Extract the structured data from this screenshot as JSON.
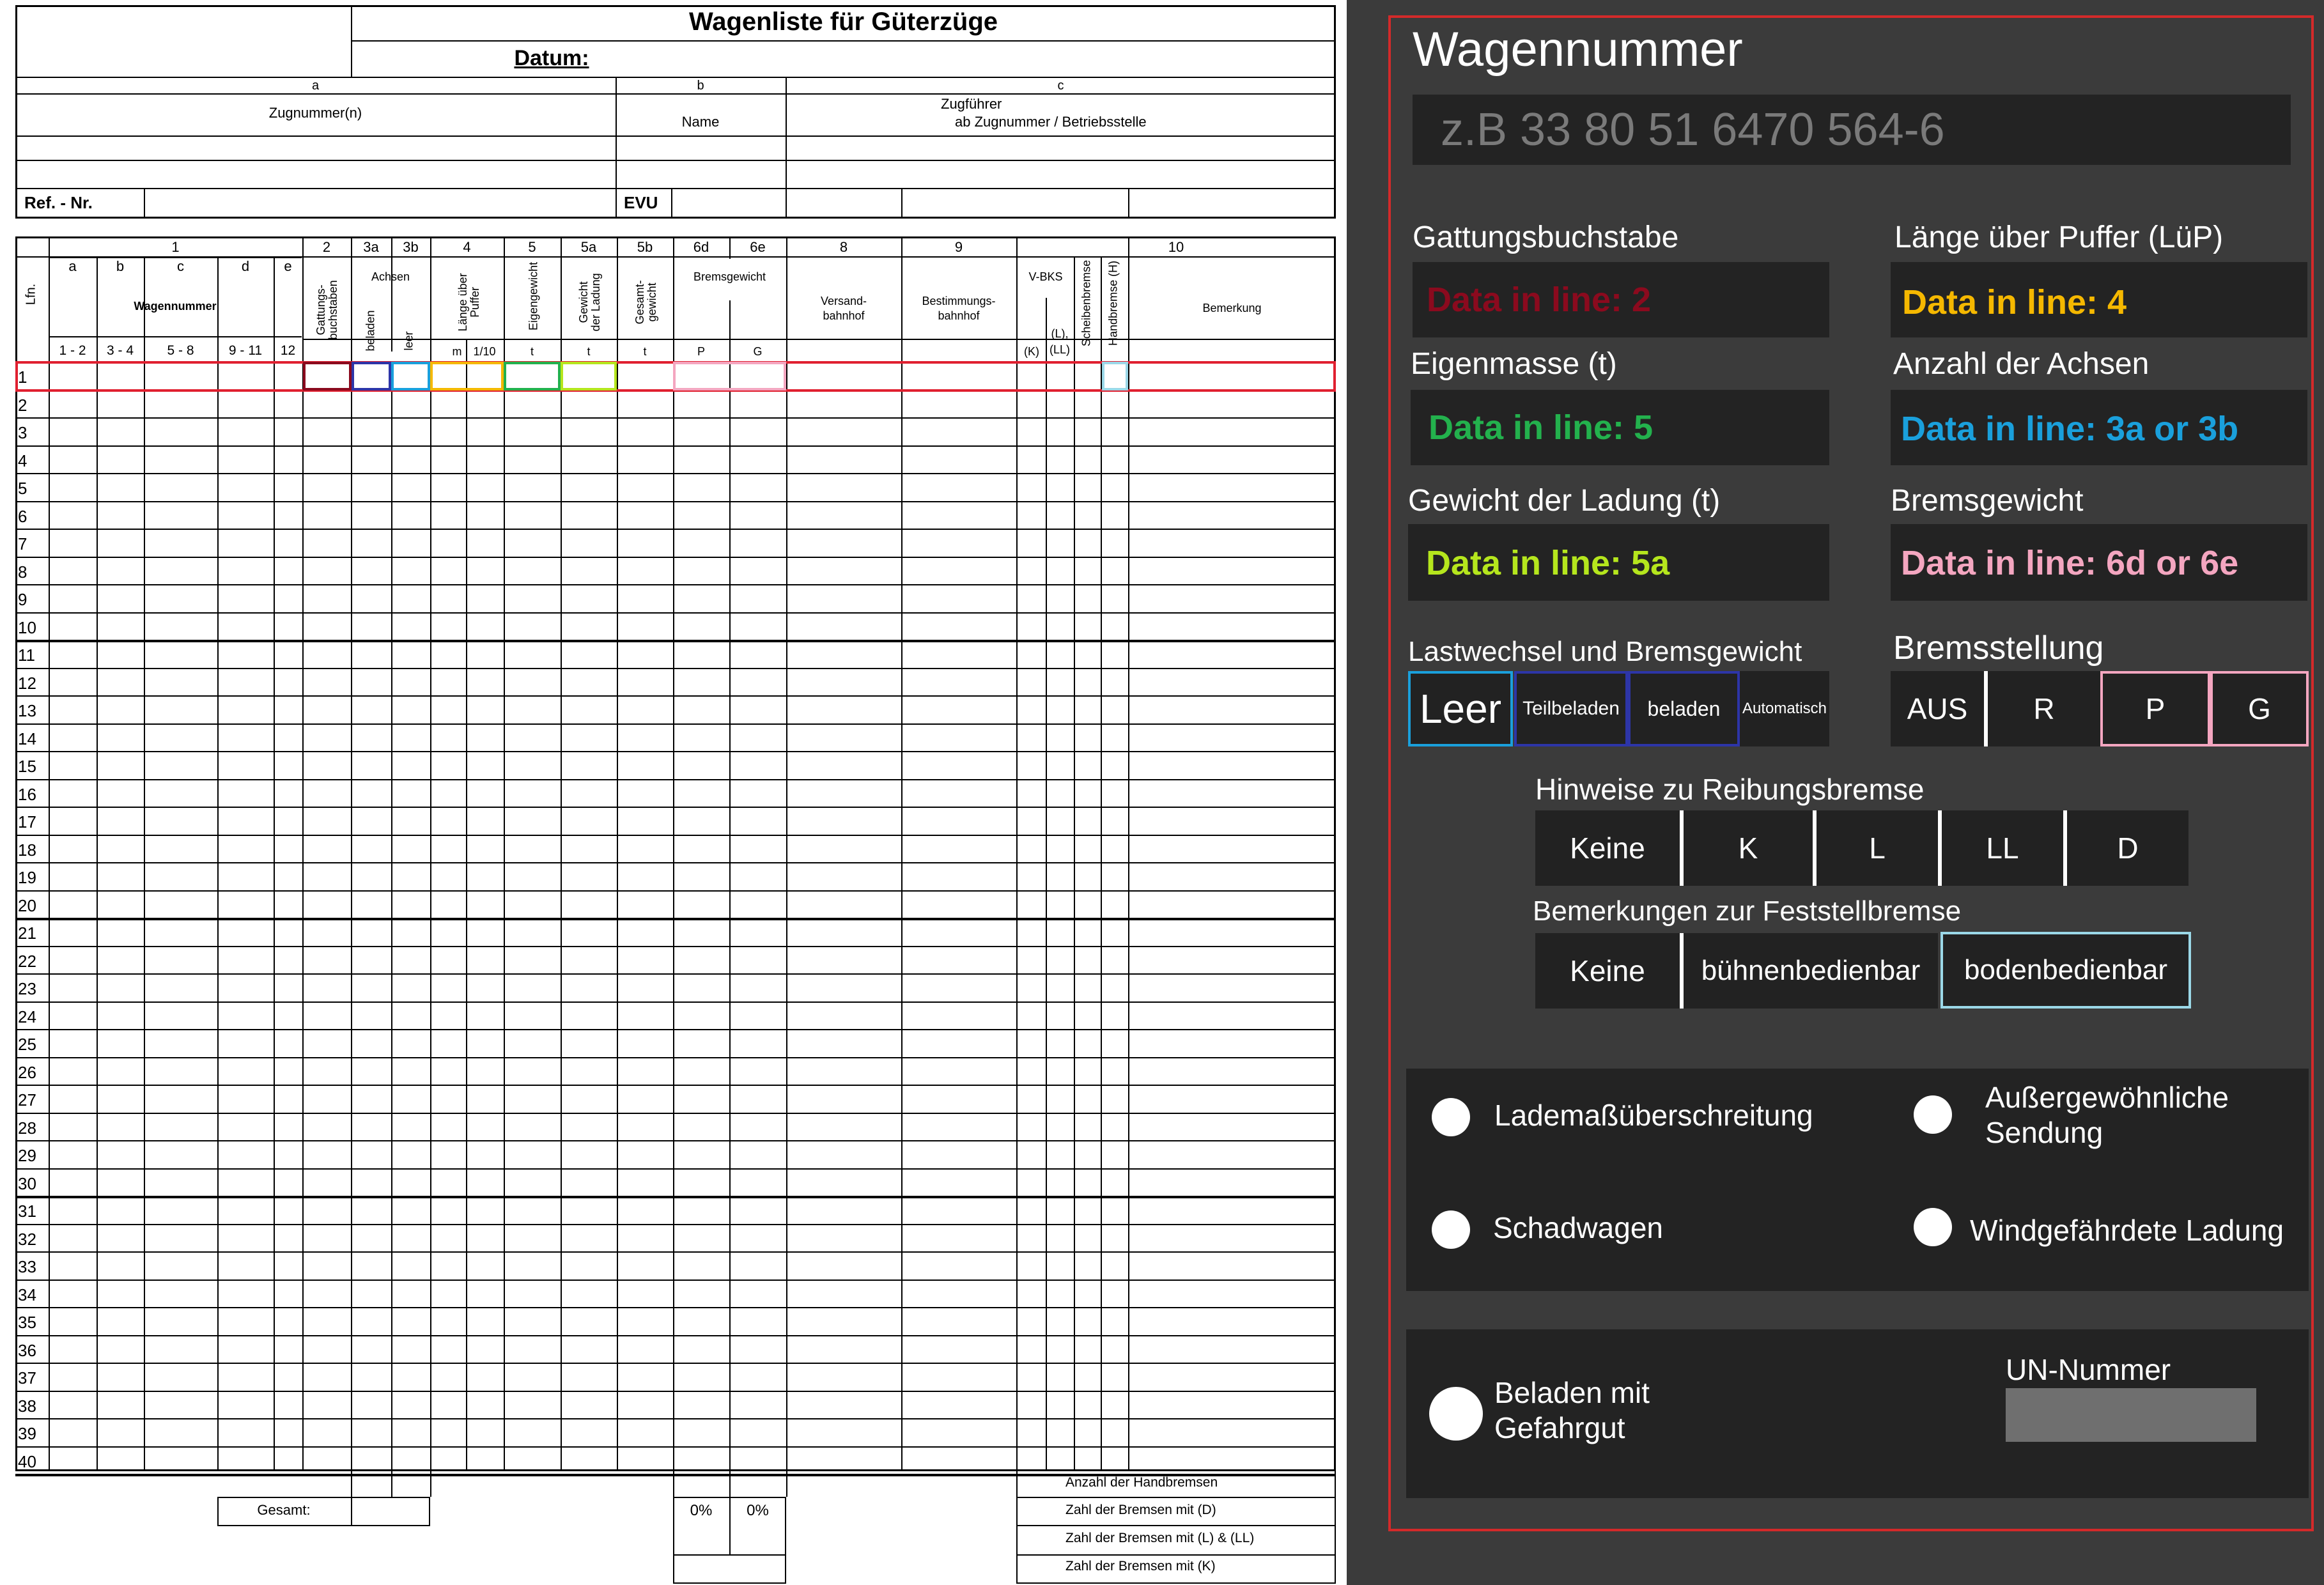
{
  "form": {
    "title": "Wagenliste für Güterzüge",
    "datum_label": "Datum:",
    "col_a": "a",
    "col_b": "b",
    "col_c": "c",
    "zugnummer": "Zugnummer(n)",
    "name": "Name",
    "zugfuehrer": "Zugführer",
    "ab_zugnummer": "ab Zugnummer / Betriebsstelle",
    "ref_nr": "Ref. - Nr.",
    "evu": "EVU",
    "colnums": [
      "1",
      "2",
      "3a",
      "3b",
      "4",
      "5",
      "5a",
      "5b",
      "6d",
      "6e",
      "8",
      "9",
      "10"
    ],
    "lfn": "Lfn.",
    "sub_letters": [
      "a",
      "b",
      "c",
      "d",
      "e"
    ],
    "wagennummer": "Wagennummer",
    "digit_groups": [
      "1 - 2",
      "3 - 4",
      "5 - 8",
      "9 - 11",
      "12"
    ],
    "gattung": "Gattungs-\nbuchstaben",
    "achsen": "Achsen",
    "beladen": "beladen",
    "leer": "leer",
    "laenge": "Länge über\nPuffer",
    "m": "m",
    "zehntel": "1/10",
    "eigengewicht": "Eigengewicht",
    "gewicht_ladung": "Gewicht\nder Ladung",
    "gesamtgewicht": "Gesamt-\ngewicht",
    "t": "t",
    "bremsgewicht": "Bremsgewicht",
    "p": "P",
    "g": "G",
    "versand": "Versand-\nbahnhof",
    "bestimmung": "Bestimmungs-\nbahnhof",
    "vbks": "V-BKS",
    "k_paren": "(K)",
    "l_ll": "(L),\n(LL)",
    "scheibenbremse": "Scheibenbremse",
    "handbremse": "Handbremse (H)",
    "bemerkung": "Bemerkung",
    "gesamt": "Gesamt:",
    "pct_p": "0%",
    "pct_g": "0%",
    "anzahl_hand": "Anzahl der Handbremsen",
    "zahl_d": "Zahl der Bremsen mit (D)",
    "zahl_l": "Zahl der Bremsen mit (L) & (LL)",
    "zahl_k": "Zahl der Bremsen mit (K)",
    "row_count": 40
  },
  "app": {
    "wagennummer_label": "Wagennummer",
    "wagennummer_placeholder": "z.B 33 80 51 6470 564-6",
    "gattung_label": "Gattungsbuchstabe",
    "gattung_value": "Data in line: 2",
    "laenge_label": "Länge über Puffer (LüP)",
    "laenge_value": "Data in line: 4",
    "eigenmasse_label": "Eigenmasse (t)",
    "eigenmasse_value": "Data in line: 5",
    "achsen_label": "Anzahl der Achsen",
    "achsen_value": "Data in line: 3a or 3b",
    "ladung_label": "Gewicht der Ladung (t)",
    "ladung_value": "Data in line: 5a",
    "brems_label": "Bremsgewicht",
    "brems_value": "Data in line: 6d or 6e",
    "lastwechsel_label": "Lastwechsel und Bremsgewicht",
    "lastwechsel_options": [
      "Leer",
      "Teilbeladen",
      "beladen",
      "Automatisch"
    ],
    "bremsstellung_label": "Bremsstellung",
    "bremsstellung_options": [
      "AUS",
      "R",
      "P",
      "G"
    ],
    "reibung_label": "Hinweise zu Reibungsbremse",
    "reibung_options": [
      "Keine",
      "K",
      "L",
      "LL",
      "D"
    ],
    "feststell_label": "Bemerkungen zur Feststellbremse",
    "feststell_options": [
      "Keine",
      "bühnenbedienbar",
      "bodenbedienbar"
    ],
    "checks": [
      "Lademaßüberschreitung",
      "Außergewöhnliche\nSendung",
      "Schadwagen",
      "Windgefährdete Ladung"
    ],
    "gefahrgut_label": "Beladen mit\nGefahrgut",
    "un_label": "UN-Nummer",
    "colors": {
      "gattung": "#8b0a1e",
      "laenge": "#f5b800",
      "eigenmasse": "#23b14d",
      "achsen": "#1aa0dc",
      "ladung": "#b5e61d",
      "brems": "#f4a6c0",
      "frame": "#d32a2a"
    }
  }
}
